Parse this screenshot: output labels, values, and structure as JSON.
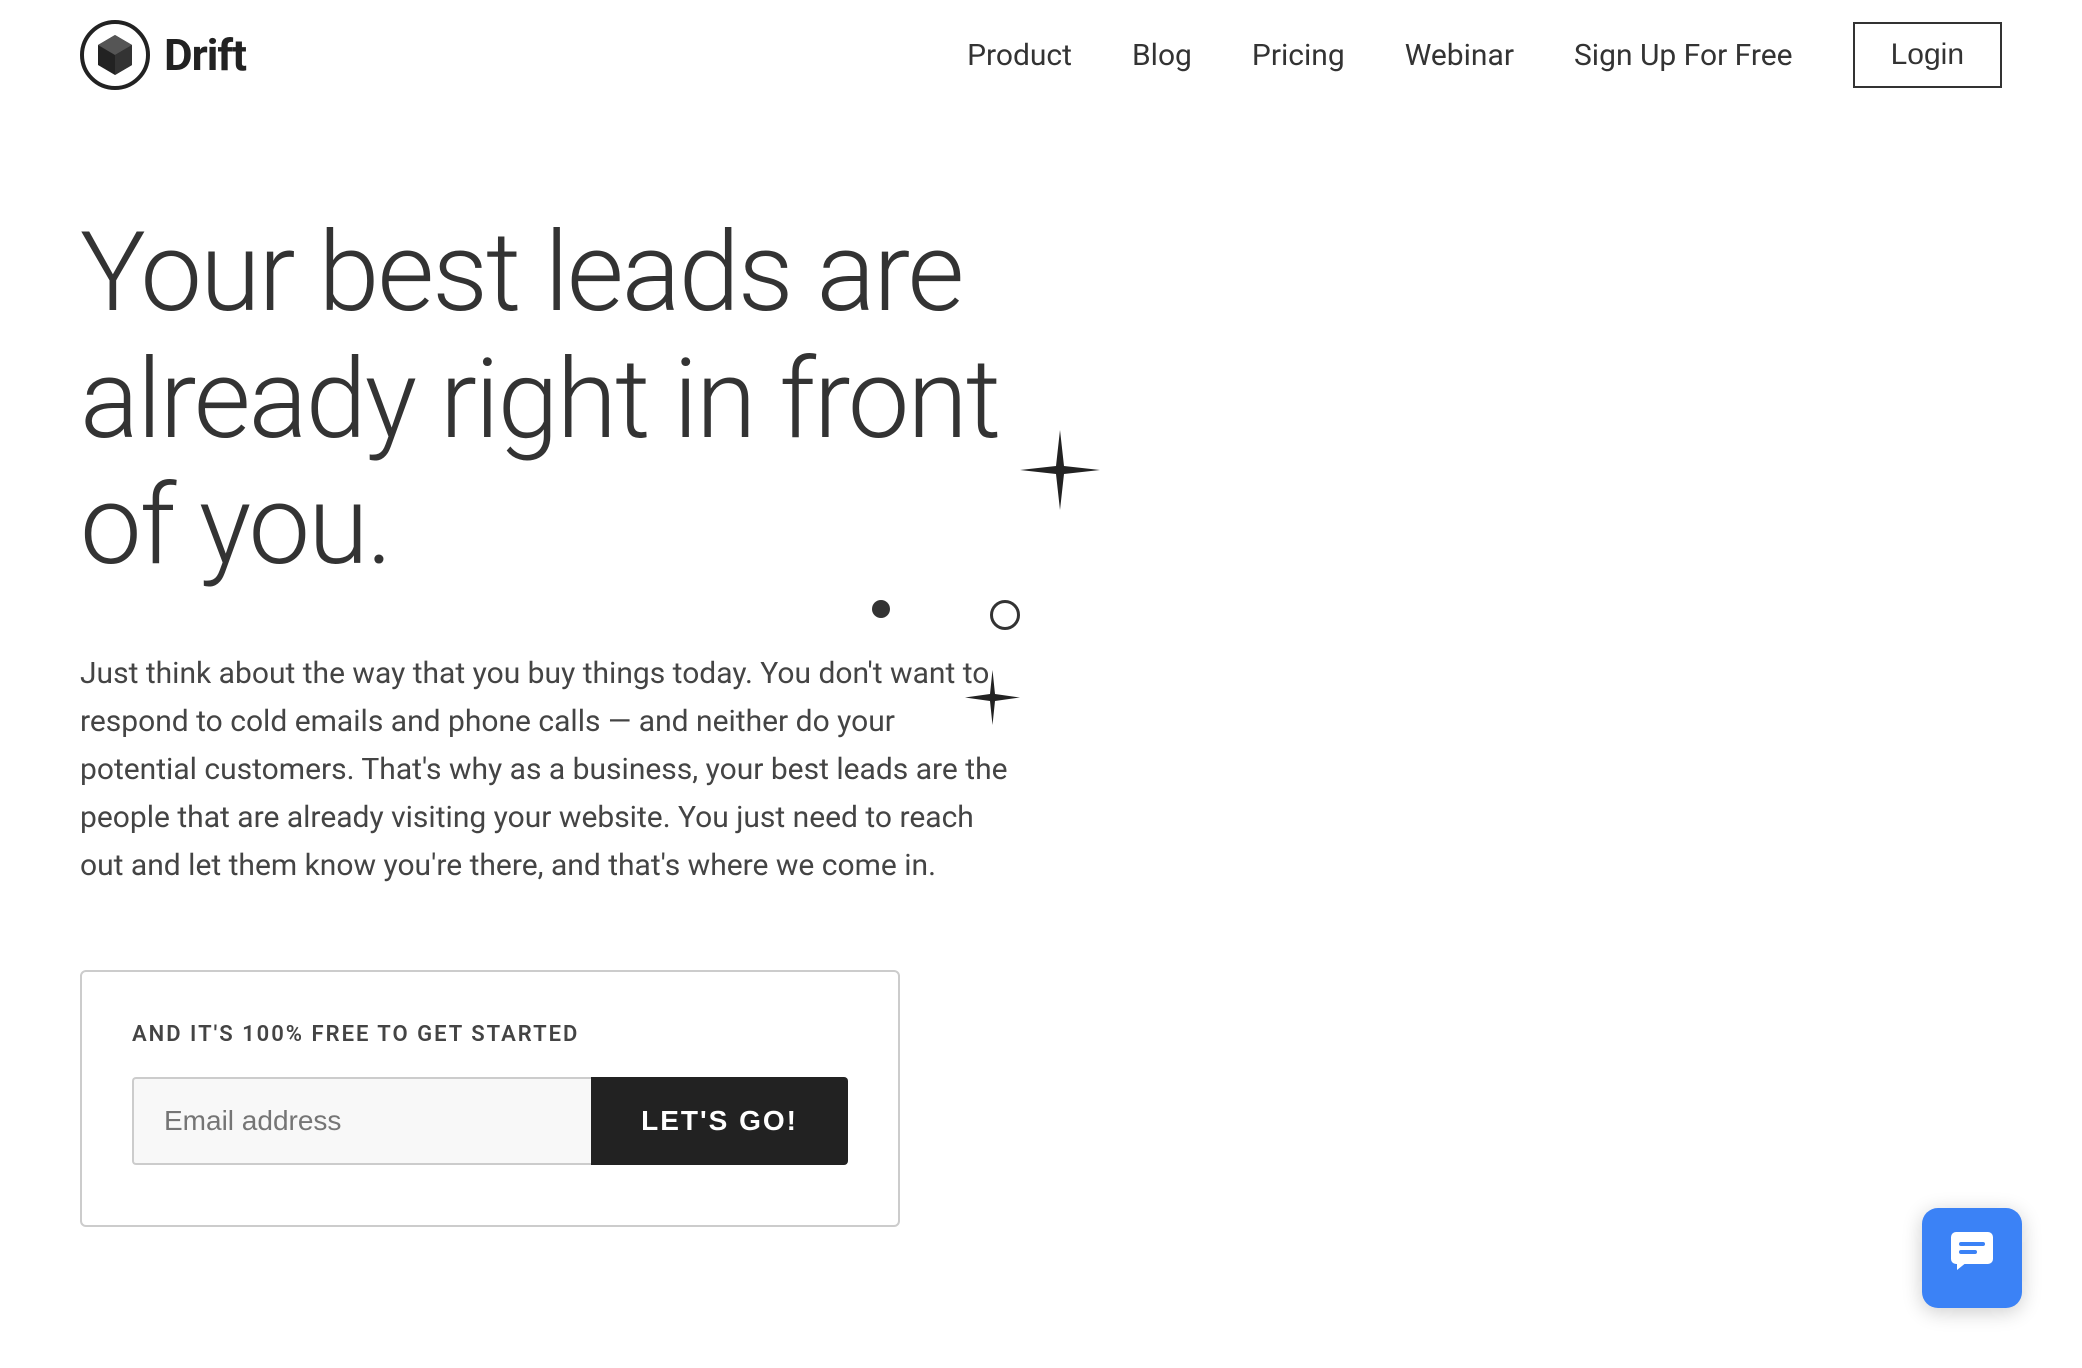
{
  "brand": {
    "name": "Drift",
    "logo_alt": "Drift logo"
  },
  "nav": {
    "items": [
      {
        "label": "Product",
        "id": "product"
      },
      {
        "label": "Blog",
        "id": "blog"
      },
      {
        "label": "Pricing",
        "id": "pricing"
      },
      {
        "label": "Webinar",
        "id": "webinar"
      }
    ],
    "signup_label": "Sign Up For Free",
    "login_label": "Login"
  },
  "hero": {
    "headline": "Your best leads are already right in front of you.",
    "subtext": "Just think about the way that you buy things today. You don't want to respond to cold emails and phone calls — and neither do your potential customers. That's why as a business, your best leads are the people that are already visiting your website. You just need to reach out and let them know you're there, and that's where we come in.",
    "cta": {
      "label": "AND IT'S 100% FREE TO GET STARTED",
      "email_placeholder": "Email address",
      "button_label": "LET'S GO!"
    }
  },
  "chat_widget": {
    "aria_label": "Open chat"
  }
}
